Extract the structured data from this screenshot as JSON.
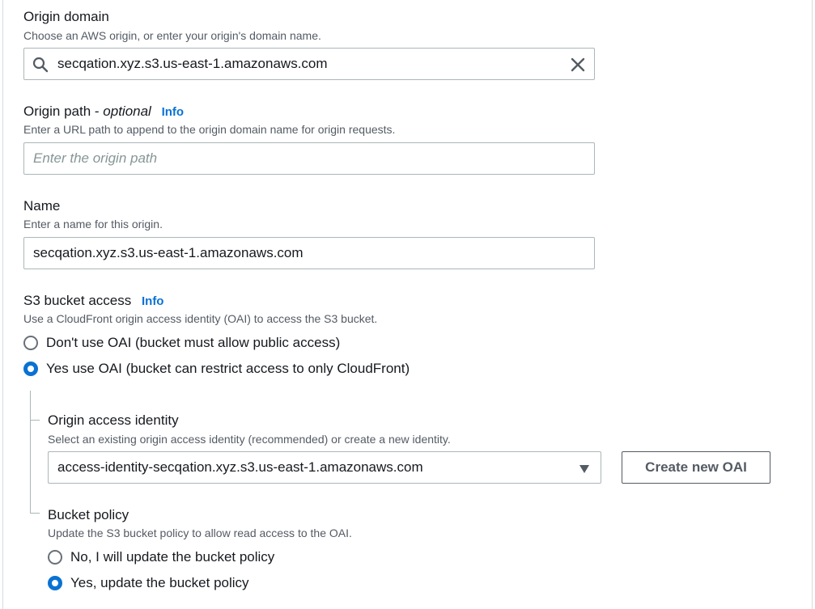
{
  "origin_domain": {
    "label": "Origin domain",
    "description": "Choose an AWS origin, or enter your origin's domain name.",
    "value": "secqation.xyz.s3.us-east-1.amazonaws.com"
  },
  "origin_path": {
    "label": "Origin path -",
    "optional": "optional",
    "info": "Info",
    "description": "Enter a URL path to append to the origin domain name for origin requests.",
    "placeholder": "Enter the origin path"
  },
  "name": {
    "label": "Name",
    "description": "Enter a name for this origin.",
    "value": "secqation.xyz.s3.us-east-1.amazonaws.com"
  },
  "s3_access": {
    "label": "S3 bucket access",
    "info": "Info",
    "description": "Use a CloudFront origin access identity (OAI) to access the S3 bucket.",
    "options": [
      {
        "label": "Don't use OAI (bucket must allow public access)",
        "selected": false
      },
      {
        "label": "Yes use OAI (bucket can restrict access to only CloudFront)",
        "selected": true
      }
    ]
  },
  "oai": {
    "label": "Origin access identity",
    "description": "Select an existing origin access identity (recommended) or create a new identity.",
    "selected": "access-identity-secqation.xyz.s3.us-east-1.amazonaws.com",
    "create_button": "Create new OAI"
  },
  "bucket_policy": {
    "label": "Bucket policy",
    "description": "Update the S3 bucket policy to allow read access to the OAI.",
    "options": [
      {
        "label": "No, I will update the bucket policy",
        "selected": false
      },
      {
        "label": "Yes, update the bucket policy",
        "selected": true
      }
    ]
  },
  "icons": {
    "search": "search-icon",
    "clear": "close-icon",
    "dropdown": "caret-down-icon"
  },
  "colors": {
    "accent": "#0972d3",
    "text": "#16191f",
    "muted": "#545b64",
    "border": "#aab7b8"
  }
}
